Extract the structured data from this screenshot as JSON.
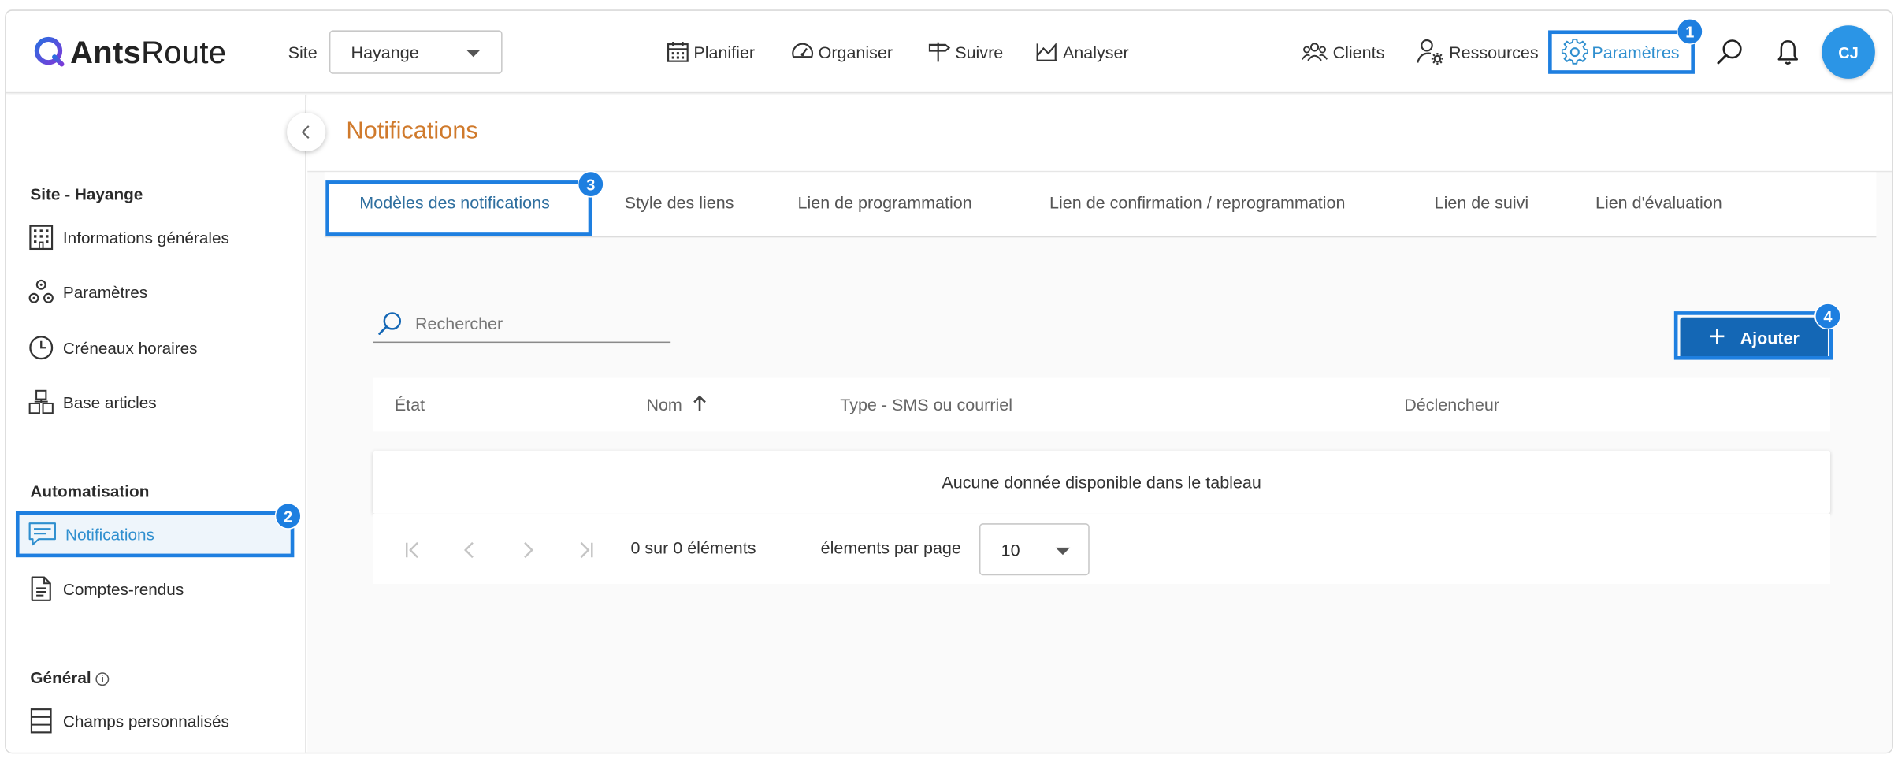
{
  "app": {
    "brand_bold": "Ants",
    "brand_light": "Route",
    "avatar_initials": "CJ",
    "accent_color": "#1e7fe0",
    "title_color": "#d07a2c"
  },
  "header": {
    "site_label": "Site",
    "site_value": "Hayange",
    "nav": [
      {
        "label": "Planifier",
        "icon": "calendar-icon"
      },
      {
        "label": "Organiser",
        "icon": "gauge-icon"
      },
      {
        "label": "Suivre",
        "icon": "signpost-icon"
      },
      {
        "label": "Analyser",
        "icon": "chart-area-icon"
      }
    ],
    "right_nav": [
      {
        "label": "Clients",
        "icon": "users-icon"
      },
      {
        "label": "Ressources",
        "icon": "user-gear-icon"
      },
      {
        "label": "Paramètres",
        "icon": "gear-icon"
      }
    ]
  },
  "annotations": {
    "b1": "1",
    "b2": "2",
    "b3": "3",
    "b4": "4"
  },
  "sidebar": {
    "section_site": "Site - Hayange",
    "items_site": [
      {
        "label": "Informations générales",
        "icon": "building-icon"
      },
      {
        "label": "Paramètres",
        "icon": "settings-cluster-icon"
      },
      {
        "label": "Créneaux horaires",
        "icon": "clock-icon"
      },
      {
        "label": "Base articles",
        "icon": "boxes-icon"
      }
    ],
    "section_auto": "Automatisation",
    "items_auto": [
      {
        "label": "Notifications",
        "icon": "chat-icon"
      },
      {
        "label": "Comptes-rendus",
        "icon": "document-icon"
      }
    ],
    "section_general": "Général",
    "items_general": [
      {
        "label": "Champs personnalisés",
        "icon": "list-icon"
      }
    ]
  },
  "main": {
    "title": "Notifications",
    "tabs": [
      "Modèles des notifications",
      "Style des liens",
      "Lien de programmation",
      "Lien de confirmation / reprogrammation",
      "Lien de suivi",
      "Lien d'évaluation"
    ],
    "search_placeholder": "Rechercher",
    "add_label": "Ajouter",
    "columns": [
      "État",
      "Nom",
      "Type - SMS ou courriel",
      "Déclencheur"
    ],
    "empty_message": "Aucune donnée disponible dans le tableau",
    "pager": {
      "count_text": "0 sur 0 éléments",
      "per_page_label": "élements par page",
      "per_page_value": "10"
    }
  }
}
